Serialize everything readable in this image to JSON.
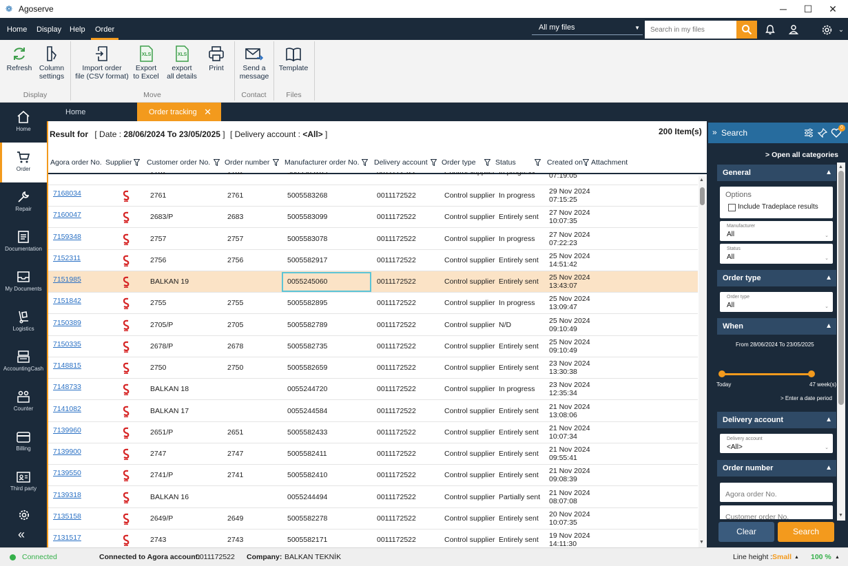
{
  "window": {
    "title": "Agoserve"
  },
  "menu": {
    "items": [
      "Home",
      "Display",
      "Help",
      "Order"
    ],
    "file_scope": "All my files",
    "search_placeholder": "Search in my files"
  },
  "ribbon": {
    "refresh": "Refresh",
    "column_settings": [
      "Column",
      "settings"
    ],
    "group_display": "Display",
    "import": [
      "Import order",
      "file (CSV format)"
    ],
    "export_excel": [
      "Export",
      "to Excel"
    ],
    "export_all": [
      "export",
      "all details"
    ],
    "print": "Print",
    "group_move": "Move",
    "send_message": [
      "Send a",
      "message"
    ],
    "group_contact": "Contact",
    "template": "Template",
    "group_files": "Files",
    "xls": "XLS"
  },
  "nav": [
    "Home",
    "Order",
    "Repair",
    "Documentation",
    "My Documents",
    "Logistics",
    "AccountingCash",
    "Counter",
    "Billing",
    "Third party"
  ],
  "tabs": {
    "home": "Home",
    "orders": "Order tracking"
  },
  "result": {
    "label": "Result for",
    "date_prefix": "[ Date : ",
    "date_range": "28/06/2024 To 23/05/2025",
    "date_suffix": " ]",
    "account_prefix": "[ Delivery account : ",
    "account_value": "<All>",
    "account_suffix": " ]",
    "count": "200 Item(s)"
  },
  "columns": [
    "Agora order No.",
    "Supplier",
    "Customer order No.",
    "Order number",
    "Manufacturer order No.",
    "Delivery account",
    "Order type",
    "Status",
    "Created on",
    "Attachment"
  ],
  "partial_row": {
    "customer": "2762",
    "order": "2762",
    "manufacturer": "5005583285",
    "account": "0011172522",
    "type": "Control supplier",
    "status": "In progress",
    "time": "07:19:05"
  },
  "rows": [
    {
      "agora": "7168034",
      "customer": "2761",
      "order": "2761",
      "manufacturer": "5005583268",
      "account": "0011172522",
      "type": "Control supplier",
      "status": "In progress",
      "date": "29 Nov 2024",
      "time": "07:15:25"
    },
    {
      "agora": "7160047",
      "customer": "2683/P",
      "order": "2683",
      "manufacturer": "5005583099",
      "account": "0011172522",
      "type": "Control supplier",
      "status": "Entirely sent",
      "date": "27 Nov 2024",
      "time": "10:07:35"
    },
    {
      "agora": "7159348",
      "customer": "2757",
      "order": "2757",
      "manufacturer": "5005583078",
      "account": "0011172522",
      "type": "Control supplier",
      "status": "In progress",
      "date": "27 Nov 2024",
      "time": "07:22:23"
    },
    {
      "agora": "7152311",
      "customer": "2756",
      "order": "2756",
      "manufacturer": "5005582917",
      "account": "0011172522",
      "type": "Control supplier",
      "status": "Entirely sent",
      "date": "25 Nov 2024",
      "time": "14:51:42"
    },
    {
      "agora": "7151985",
      "customer": "BALKAN 19",
      "order": "",
      "manufacturer": "0055245060",
      "account": "0011172522",
      "type": "Control supplier",
      "status": "Entirely sent",
      "date": "25 Nov 2024",
      "time": "13:43:07"
    },
    {
      "agora": "7151842",
      "customer": "2755",
      "order": "2755",
      "manufacturer": "5005582895",
      "account": "0011172522",
      "type": "Control supplier",
      "status": "In progress",
      "date": "25 Nov 2024",
      "time": "13:09:47"
    },
    {
      "agora": "7150389",
      "customer": "2705/P",
      "order": "2705",
      "manufacturer": "5005582789",
      "account": "0011172522",
      "type": "Control supplier",
      "status": "N/D",
      "date": "25 Nov 2024",
      "time": "09:10:49"
    },
    {
      "agora": "7150335",
      "customer": "2678/P",
      "order": "2678",
      "manufacturer": "5005582735",
      "account": "0011172522",
      "type": "Control supplier",
      "status": "Entirely sent",
      "date": "25 Nov 2024",
      "time": "09:10:49"
    },
    {
      "agora": "7148815",
      "customer": "2750",
      "order": "2750",
      "manufacturer": "5005582659",
      "account": "0011172522",
      "type": "Control supplier",
      "status": "Entirely sent",
      "date": "23 Nov 2024",
      "time": "13:30:38"
    },
    {
      "agora": "7148733",
      "customer": "BALKAN 18",
      "order": "",
      "manufacturer": "0055244720",
      "account": "0011172522",
      "type": "Control supplier",
      "status": "In progress",
      "date": "23 Nov 2024",
      "time": "12:35:34"
    },
    {
      "agora": "7141082",
      "customer": "BALKAN 17",
      "order": "",
      "manufacturer": "0055244584",
      "account": "0011172522",
      "type": "Control supplier",
      "status": "Entirely sent",
      "date": "21 Nov 2024",
      "time": "13:08:06"
    },
    {
      "agora": "7139960",
      "customer": "2651/P",
      "order": "2651",
      "manufacturer": "5005582433",
      "account": "0011172522",
      "type": "Control supplier",
      "status": "Entirely sent",
      "date": "21 Nov 2024",
      "time": "10:07:34"
    },
    {
      "agora": "7139900",
      "customer": "2747",
      "order": "2747",
      "manufacturer": "5005582411",
      "account": "0011172522",
      "type": "Control supplier",
      "status": "Entirely sent",
      "date": "21 Nov 2024",
      "time": "09:55:41"
    },
    {
      "agora": "7139550",
      "customer": "2741/P",
      "order": "2741",
      "manufacturer": "5005582410",
      "account": "0011172522",
      "type": "Control supplier",
      "status": "Entirely sent",
      "date": "21 Nov 2024",
      "time": "09:08:39"
    },
    {
      "agora": "7139318",
      "customer": "BALKAN 16",
      "order": "",
      "manufacturer": "0055244494",
      "account": "0011172522",
      "type": "Control supplier",
      "status": "Partially sent",
      "date": "21 Nov 2024",
      "time": "08:07:08"
    },
    {
      "agora": "7135158",
      "customer": "2649/P",
      "order": "2649",
      "manufacturer": "5005582278",
      "account": "0011172522",
      "type": "Control supplier",
      "status": "Entirely sent",
      "date": "20 Nov 2024",
      "time": "10:07:35"
    },
    {
      "agora": "7131517",
      "customer": "2743",
      "order": "2743",
      "manufacturer": "5005582171",
      "account": "0011172522",
      "type": "Control supplier",
      "status": "Entirely sent",
      "date": "19 Nov 2024",
      "time": "14:11:30"
    }
  ],
  "selected_row": 4,
  "panel": {
    "title": "Search",
    "badge": "0",
    "open_all": "Open all categories",
    "general": "General",
    "options": "Options",
    "tradeplace": "Include Tradeplace results",
    "manufacturer_label": "Manufacturer",
    "manufacturer_value": "All",
    "status_label": "Status",
    "status_value": "All",
    "order_type": "Order type",
    "order_type_label": "Order type",
    "order_type_value": "All",
    "when": "When",
    "when_range": "From 28/06/2024 To 23/05/2025",
    "today": "Today",
    "weeks": "47 week(s)",
    "enter_period": "> Enter a date period",
    "slider_fraction": 1.0,
    "delivery_account": "Delivery account",
    "delivery_label": "Delivery account",
    "delivery_value": "<All>",
    "order_number": "Order number",
    "agora_placeholder": "Agora order No.",
    "customer_placeholder": "Customer order No.",
    "clear": "Clear",
    "search": "Search"
  },
  "status": {
    "connected": "Connected",
    "account_label": "Connected to Agora account:",
    "account": "0011172522",
    "company_label": "Company:",
    "company": "BALKAN TEKNİK",
    "line_height_label": "Line height :",
    "line_height": "Small",
    "zoom": "100 %"
  },
  "colors": {
    "dark": "#1b2a3a",
    "accent": "#f39a1d",
    "link": "#2970c4",
    "connected": "#35b04a"
  }
}
